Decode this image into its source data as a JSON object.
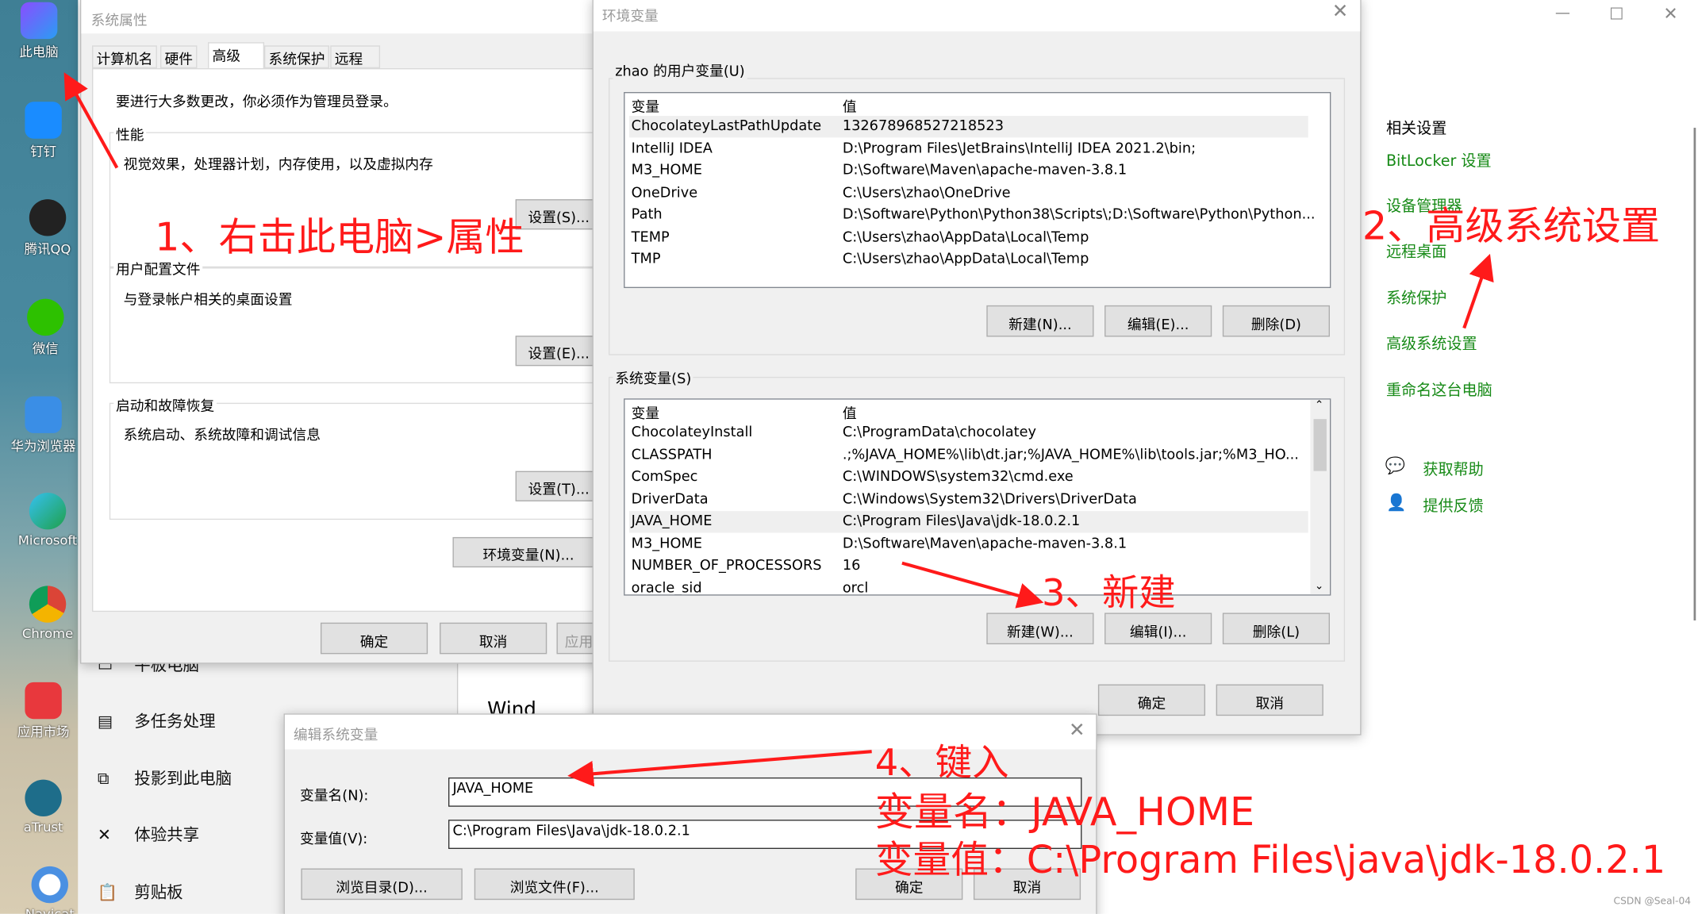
{
  "desktop": {
    "icons": [
      "此电脑",
      "钉钉",
      "腾讯QQ",
      "微信",
      "华为浏览器",
      "Microsoft",
      "Chrome",
      "应用市场",
      "aTrust",
      "Navicat"
    ]
  },
  "settings": {
    "nav": [
      "平板电脑",
      "多任务处理",
      "投影到此电脑",
      "体验共享",
      "剪贴板"
    ],
    "partial_text": "Wind",
    "related_heading": "相关设置",
    "links": [
      "BitLocker 设置",
      "设备管理器",
      "远程桌面",
      "系统保护",
      "高级系统设置",
      "重命名这台电脑"
    ],
    "help": "获取帮助",
    "feedback": "提供反馈",
    "accent": "#168a16"
  },
  "sysprops": {
    "title": "系统属性",
    "tabs": [
      "计算机名",
      "硬件",
      "高级",
      "系统保护",
      "远程"
    ],
    "active_tab": "高级",
    "admin_note": "要进行大多数更改，你必须作为管理员登录。",
    "perf_label": "性能",
    "perf_desc": "视觉效果，处理器计划，内存使用，以及虚拟内存",
    "perf_btn": "设置(S)...",
    "profile_label": "用户配置文件",
    "profile_desc": "与登录帐户相关的桌面设置",
    "profile_btn": "设置(E)...",
    "startup_label": "启动和故障恢复",
    "startup_desc": "系统启动、系统故障和调试信息",
    "startup_btn": "设置(T)...",
    "env_btn": "环境变量(N)...",
    "ok": "确定",
    "cancel": "取消",
    "apply": "应用(A)"
  },
  "envvars": {
    "title": "环境变量",
    "user_label": "zhao 的用户变量(U)",
    "col_var": "变量",
    "col_val": "值",
    "user_rows": [
      [
        "ChocolateyLastPathUpdate",
        "132678968527218523"
      ],
      [
        "IntelliJ IDEA",
        "D:\\Program Files\\JetBrains\\IntelliJ IDEA 2021.2\\bin;"
      ],
      [
        "M3_HOME",
        "D:\\Software\\Maven\\apache-maven-3.8.1"
      ],
      [
        "OneDrive",
        "C:\\Users\\zhao\\OneDrive"
      ],
      [
        "Path",
        "D:\\Software\\Python\\Python38\\Scripts\\;D:\\Software\\Python\\Python..."
      ],
      [
        "TEMP",
        "C:\\Users\\zhao\\AppData\\Local\\Temp"
      ],
      [
        "TMP",
        "C:\\Users\\zhao\\AppData\\Local\\Temp"
      ]
    ],
    "user_buttons": [
      "新建(N)...",
      "编辑(E)...",
      "删除(D)"
    ],
    "sys_label": "系统变量(S)",
    "sys_rows": [
      [
        "ChocolateyInstall",
        "C:\\ProgramData\\chocolatey"
      ],
      [
        "CLASSPATH",
        ".;%JAVA_HOME%\\lib\\dt.jar;%JAVA_HOME%\\lib\\tools.jar;%M3_HO..."
      ],
      [
        "ComSpec",
        "C:\\WINDOWS\\system32\\cmd.exe"
      ],
      [
        "DriverData",
        "C:\\Windows\\System32\\Drivers\\DriverData"
      ],
      [
        "JAVA_HOME",
        "C:\\Program Files\\Java\\jdk-18.0.2.1"
      ],
      [
        "M3_HOME",
        "D:\\Software\\Maven\\apache-maven-3.8.1"
      ],
      [
        "NUMBER_OF_PROCESSORS",
        "16"
      ],
      [
        "oracle_sid",
        "orcl"
      ]
    ],
    "sys_buttons": [
      "新建(W)...",
      "编辑(I)...",
      "删除(L)"
    ],
    "ok": "确定",
    "cancel": "取消"
  },
  "editvar": {
    "title": "编辑系统变量",
    "name_label": "变量名(N):",
    "name_value": "JAVA_HOME",
    "value_label": "变量值(V):",
    "value_value": "C:\\Program Files\\Java\\jdk-18.0.2.1",
    "browse_dir": "浏览目录(D)...",
    "browse_file": "浏览文件(F)...",
    "ok": "确定",
    "cancel": "取消"
  },
  "annotations": {
    "step1": "1、右击此电脑>属性",
    "step2": "2、高级系统设置",
    "step3": "3、新建",
    "step4": "4、键入",
    "name_hint": "变量名：JAVA_HOME",
    "value_hint": "变量值：C:\\Program Files\\java\\jdk-18.0.2.1",
    "color": "#ff1a1a"
  },
  "watermark": "CSDN @Seal-04"
}
